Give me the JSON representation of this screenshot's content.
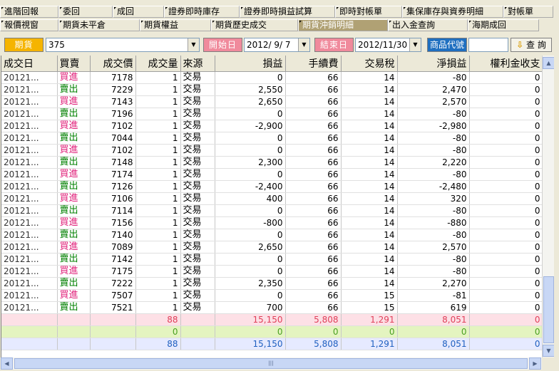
{
  "tabs_row1": [
    "進階回報",
    "委回",
    "成回",
    "證券即時庫存",
    "證券即時損益試算",
    "即時對帳單",
    "集保庫存與資券明細",
    "對帳單"
  ],
  "tabs_row2": [
    "報價視窗",
    "期貨未平倉",
    "期貨權益",
    "期貨歷史成交",
    "期貨沖銷明細",
    "出入金查詢",
    "海期成回"
  ],
  "active_tab_index": 4,
  "toolbar": {
    "product_label": "期貨",
    "product_value": "375",
    "start_label": "開始日",
    "start_value": "2012/ 9/ 7",
    "end_label": "結束日",
    "end_value": "2012/11/30",
    "code_label": "商品代號",
    "code_value": "",
    "query_label": "查 詢",
    "query_icon": "arrow-down-icon"
  },
  "colors": {
    "buy": "#e0207a",
    "sell": "#008000",
    "label_orange": "#f5b400",
    "label_pink": "#f08a9c",
    "label_blue": "#1f6fc0"
  },
  "table": {
    "columns": [
      "成交日",
      "買賣",
      "成交價",
      "成交量",
      "來源",
      "損益",
      "手續費",
      "交易稅",
      "淨損益",
      "權利金收支"
    ],
    "rows": [
      [
        "20121...",
        "買進",
        "7178",
        "1",
        "交易",
        "0",
        "66",
        "14",
        "-80",
        "0"
      ],
      [
        "20121...",
        "賣出",
        "7229",
        "1",
        "交易",
        "2,550",
        "66",
        "14",
        "2,470",
        "0"
      ],
      [
        "20121...",
        "買進",
        "7143",
        "1",
        "交易",
        "2,650",
        "66",
        "14",
        "2,570",
        "0"
      ],
      [
        "20121...",
        "賣出",
        "7196",
        "1",
        "交易",
        "0",
        "66",
        "14",
        "-80",
        "0"
      ],
      [
        "20121...",
        "買進",
        "7102",
        "1",
        "交易",
        "-2,900",
        "66",
        "14",
        "-2,980",
        "0"
      ],
      [
        "20121...",
        "賣出",
        "7044",
        "1",
        "交易",
        "0",
        "66",
        "14",
        "-80",
        "0"
      ],
      [
        "20121...",
        "買進",
        "7102",
        "1",
        "交易",
        "0",
        "66",
        "14",
        "-80",
        "0"
      ],
      [
        "20121...",
        "賣出",
        "7148",
        "1",
        "交易",
        "2,300",
        "66",
        "14",
        "2,220",
        "0"
      ],
      [
        "20121...",
        "買進",
        "7174",
        "1",
        "交易",
        "0",
        "66",
        "14",
        "-80",
        "0"
      ],
      [
        "20121...",
        "賣出",
        "7126",
        "1",
        "交易",
        "-2,400",
        "66",
        "14",
        "-2,480",
        "0"
      ],
      [
        "20121...",
        "買進",
        "7106",
        "1",
        "交易",
        "400",
        "66",
        "14",
        "320",
        "0"
      ],
      [
        "20121...",
        "賣出",
        "7114",
        "1",
        "交易",
        "0",
        "66",
        "14",
        "-80",
        "0"
      ],
      [
        "20121...",
        "買進",
        "7156",
        "1",
        "交易",
        "-800",
        "66",
        "14",
        "-880",
        "0"
      ],
      [
        "20121...",
        "賣出",
        "7140",
        "1",
        "交易",
        "0",
        "66",
        "14",
        "-80",
        "0"
      ],
      [
        "20121...",
        "買進",
        "7089",
        "1",
        "交易",
        "2,650",
        "66",
        "14",
        "2,570",
        "0"
      ],
      [
        "20121...",
        "賣出",
        "7142",
        "1",
        "交易",
        "0",
        "66",
        "14",
        "-80",
        "0"
      ],
      [
        "20121...",
        "買進",
        "7175",
        "1",
        "交易",
        "0",
        "66",
        "14",
        "-80",
        "0"
      ],
      [
        "20121...",
        "賣出",
        "7222",
        "1",
        "交易",
        "2,350",
        "66",
        "14",
        "2,270",
        "0"
      ],
      [
        "20121...",
        "買進",
        "7507",
        "1",
        "交易",
        "0",
        "66",
        "15",
        "-81",
        "0"
      ],
      [
        "20121...",
        "賣出",
        "7521",
        "1",
        "交易",
        "700",
        "66",
        "15",
        "619",
        "0"
      ]
    ],
    "summary": [
      [
        "",
        "",
        "",
        "88",
        "",
        "15,150",
        "5,808",
        "1,291",
        "8,051",
        "0"
      ],
      [
        "",
        "",
        "",
        "0",
        "",
        "0",
        "0",
        "0",
        "0",
        "0"
      ],
      [
        "",
        "",
        "",
        "88",
        "",
        "15,150",
        "5,808",
        "1,291",
        "8,051",
        "0"
      ]
    ]
  }
}
